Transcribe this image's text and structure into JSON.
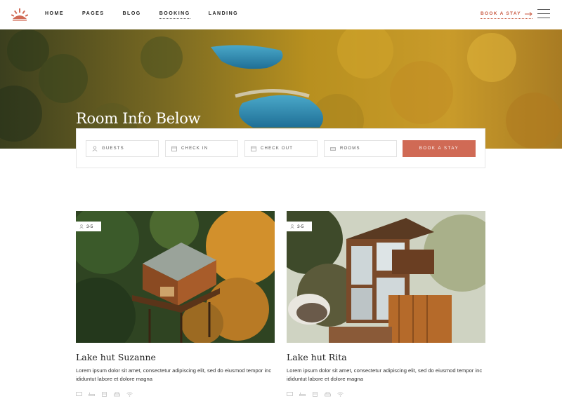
{
  "header": {
    "nav": [
      "Home",
      "Pages",
      "Blog",
      "Booking",
      "Landing"
    ],
    "active_nav": "Booking",
    "cta_label": "Book a stay",
    "logo_icon": "sun-logo-icon",
    "menu_icon": "hamburger-menu-icon"
  },
  "hero": {
    "title": "Room Info Below"
  },
  "booking": {
    "fields": [
      {
        "label": "Guests",
        "icon": "user-icon"
      },
      {
        "label": "Check in",
        "icon": "calendar-icon"
      },
      {
        "label": "Check out",
        "icon": "calendar-icon"
      },
      {
        "label": "Rooms",
        "icon": "bed-icon"
      }
    ],
    "button_label": "Book a stay"
  },
  "rooms": [
    {
      "title": "Lake hut Suzanne",
      "guests": "3-5",
      "description": "Lorem ipsum dolor sit amet, consectetur adipiscing elit, sed do eiusmod tempor inc ididuntut labore et dolore magna",
      "amenities": [
        "tv-icon",
        "bath-icon",
        "fridge-icon",
        "sofa-icon",
        "wifi-icon"
      ]
    },
    {
      "title": "Lake hut Rita",
      "guests": "3-5",
      "description": "Lorem ipsum dolor sit amet, consectetur adipiscing elit, sed do eiusmod tempor inc ididuntut labore et dolore magna",
      "amenities": [
        "tv-icon",
        "bath-icon",
        "fridge-icon",
        "sofa-icon",
        "wifi-icon"
      ]
    }
  ],
  "colors": {
    "accent": "#d06a55",
    "link": "#c8573f",
    "text": "#222222"
  }
}
